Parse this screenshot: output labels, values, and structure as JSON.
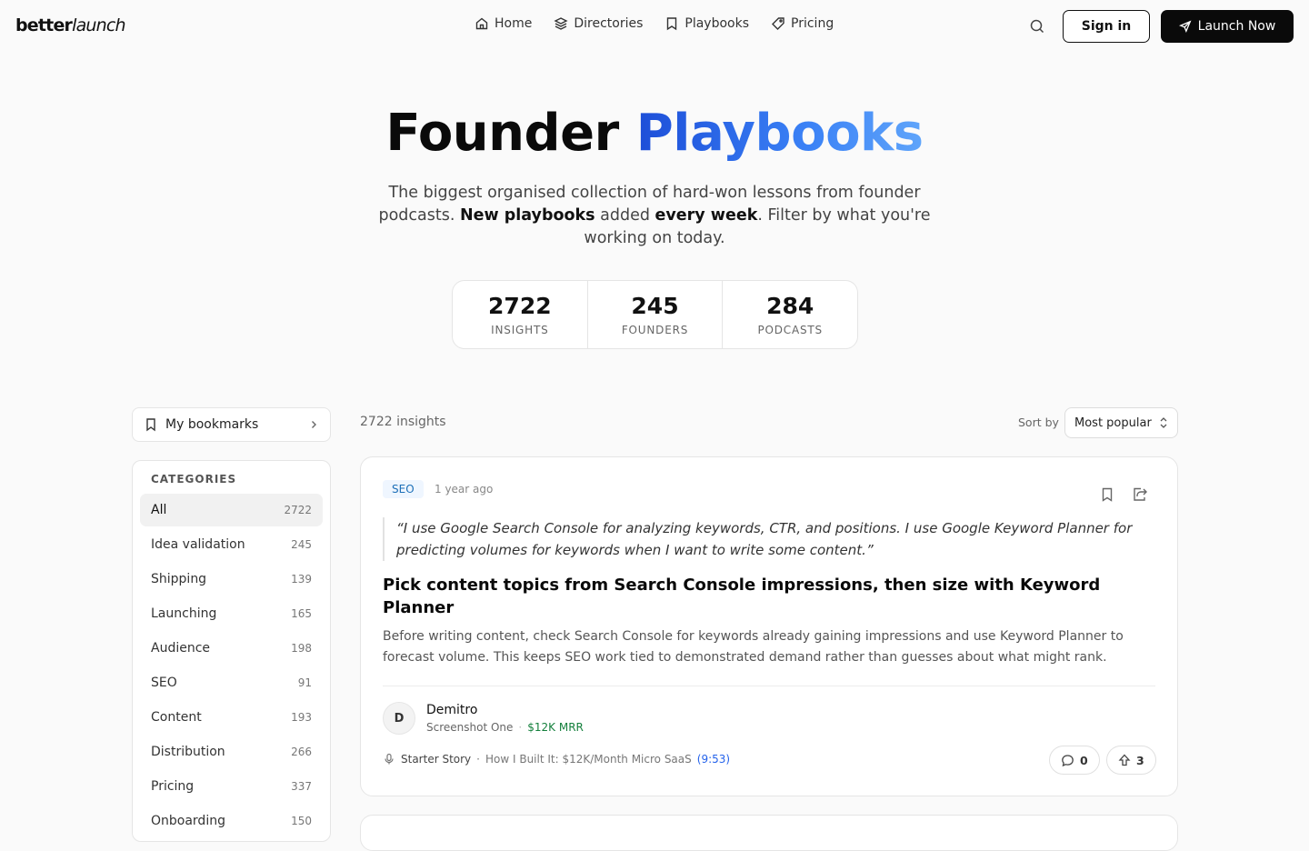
{
  "nav": {
    "logo_bold": "better",
    "logo_italic": "launch",
    "links": [
      {
        "label": "Home",
        "icon": "house-icon"
      },
      {
        "label": "Directories",
        "icon": "layers-icon"
      },
      {
        "label": "Playbooks",
        "icon": "book-icon"
      },
      {
        "label": "Pricing",
        "icon": "tag-icon"
      }
    ],
    "sign_in": "Sign in",
    "launch_now": "Launch Now"
  },
  "hero": {
    "title_plain": "Founder",
    "title_accent": "Playbooks",
    "subtitle_1": "The biggest organised collection of hard-won lessons from founder podcasts. ",
    "subtitle_bold_1": "New playbooks",
    "subtitle_2": " added ",
    "subtitle_bold_2": "every week",
    "subtitle_3": ". Filter by what you're working on today.",
    "stats": [
      {
        "value": "2722",
        "label": "INSIGHTS"
      },
      {
        "value": "245",
        "label": "FOUNDERS"
      },
      {
        "value": "284",
        "label": "PODCASTS"
      }
    ]
  },
  "sidebar": {
    "bookmarks_label": "My bookmarks",
    "categories_heading": "CATEGORIES",
    "categories": [
      {
        "name": "All",
        "count": "2722"
      },
      {
        "name": "Idea validation",
        "count": "245"
      },
      {
        "name": "Shipping",
        "count": "139"
      },
      {
        "name": "Launching",
        "count": "165"
      },
      {
        "name": "Audience",
        "count": "198"
      },
      {
        "name": "SEO",
        "count": "91"
      },
      {
        "name": "Content",
        "count": "193"
      },
      {
        "name": "Distribution",
        "count": "266"
      },
      {
        "name": "Pricing",
        "count": "337"
      },
      {
        "name": "Onboarding",
        "count": "150"
      }
    ]
  },
  "main": {
    "result_count": "2722 insights",
    "sort_label": "Sort by",
    "sort_value": "Most popular",
    "card": {
      "tag": "SEO",
      "age": "1 year ago",
      "quote": "“I use Google Search Console for analyzing keywords, CTR, and positions. I use Google Keyword Planner for predicting volumes for keywords when I want to write some content.”",
      "title": "Pick content topics from Search Console impressions, then size with Keyword Planner",
      "description": "Before writing content, check Search Console for keywords already gaining impressions and use Keyword Planner to forecast volume. This keeps SEO work tied to demonstrated demand rather than guesses about what might rank.",
      "author_initial": "D",
      "author_name": "Demitro",
      "author_product": "Screenshot One",
      "author_mrr": "$12K MRR",
      "podcast": "Starter Story",
      "episode": "How I Built It: $12K/Month Micro SaaS",
      "timestamp": "(9:53)",
      "comments": "0",
      "upvotes": "3"
    }
  },
  "colors": {
    "accent": "#3b82f6",
    "primary_button": "#0a0a0a",
    "mrr_green": "#15803d",
    "tag_blue": "#1d6fb8"
  }
}
